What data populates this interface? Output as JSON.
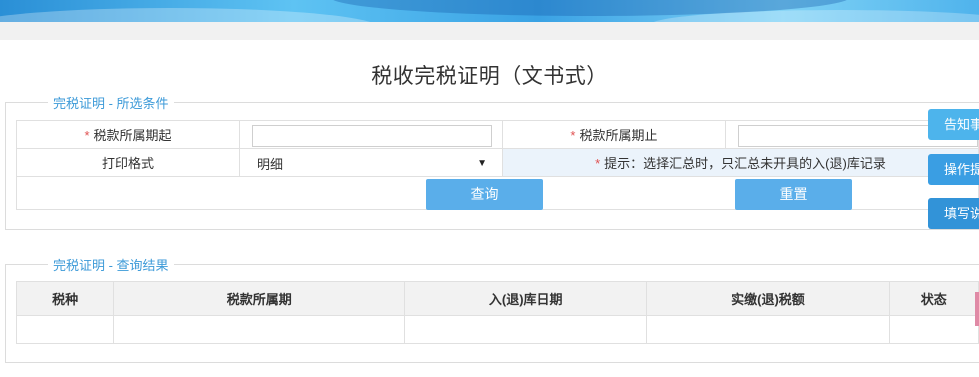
{
  "page": {
    "title": "税收完税证明（文书式）"
  },
  "conditions": {
    "legend": "完税证明 - 所选条件",
    "period_start_label": "税款所属期起",
    "period_start_value": "",
    "period_end_label": "税款所属期止",
    "period_end_value": "",
    "print_format_label": "打印格式",
    "print_format_value": "明细",
    "hint": "提示：选择汇总时，只汇总未开具的入(退)库记录",
    "required_mark": "*",
    "query_button": "查询",
    "reset_button": "重置"
  },
  "side_buttons": [
    {
      "label": "告知事"
    },
    {
      "label": "操作提"
    },
    {
      "label": "填写说"
    }
  ],
  "results": {
    "legend": "完税证明 - 查询结果",
    "columns": [
      "税种",
      "税款所属期",
      "入(退)库日期",
      "实缴(退)税额",
      "状态"
    ],
    "rows": [
      [
        "",
        "",
        "",
        "",
        ""
      ]
    ]
  },
  "colors": {
    "accent": "#3c9ad8",
    "button": "#5aaeea",
    "hint_bg": "#ebf3fb",
    "required": "#e05050"
  }
}
